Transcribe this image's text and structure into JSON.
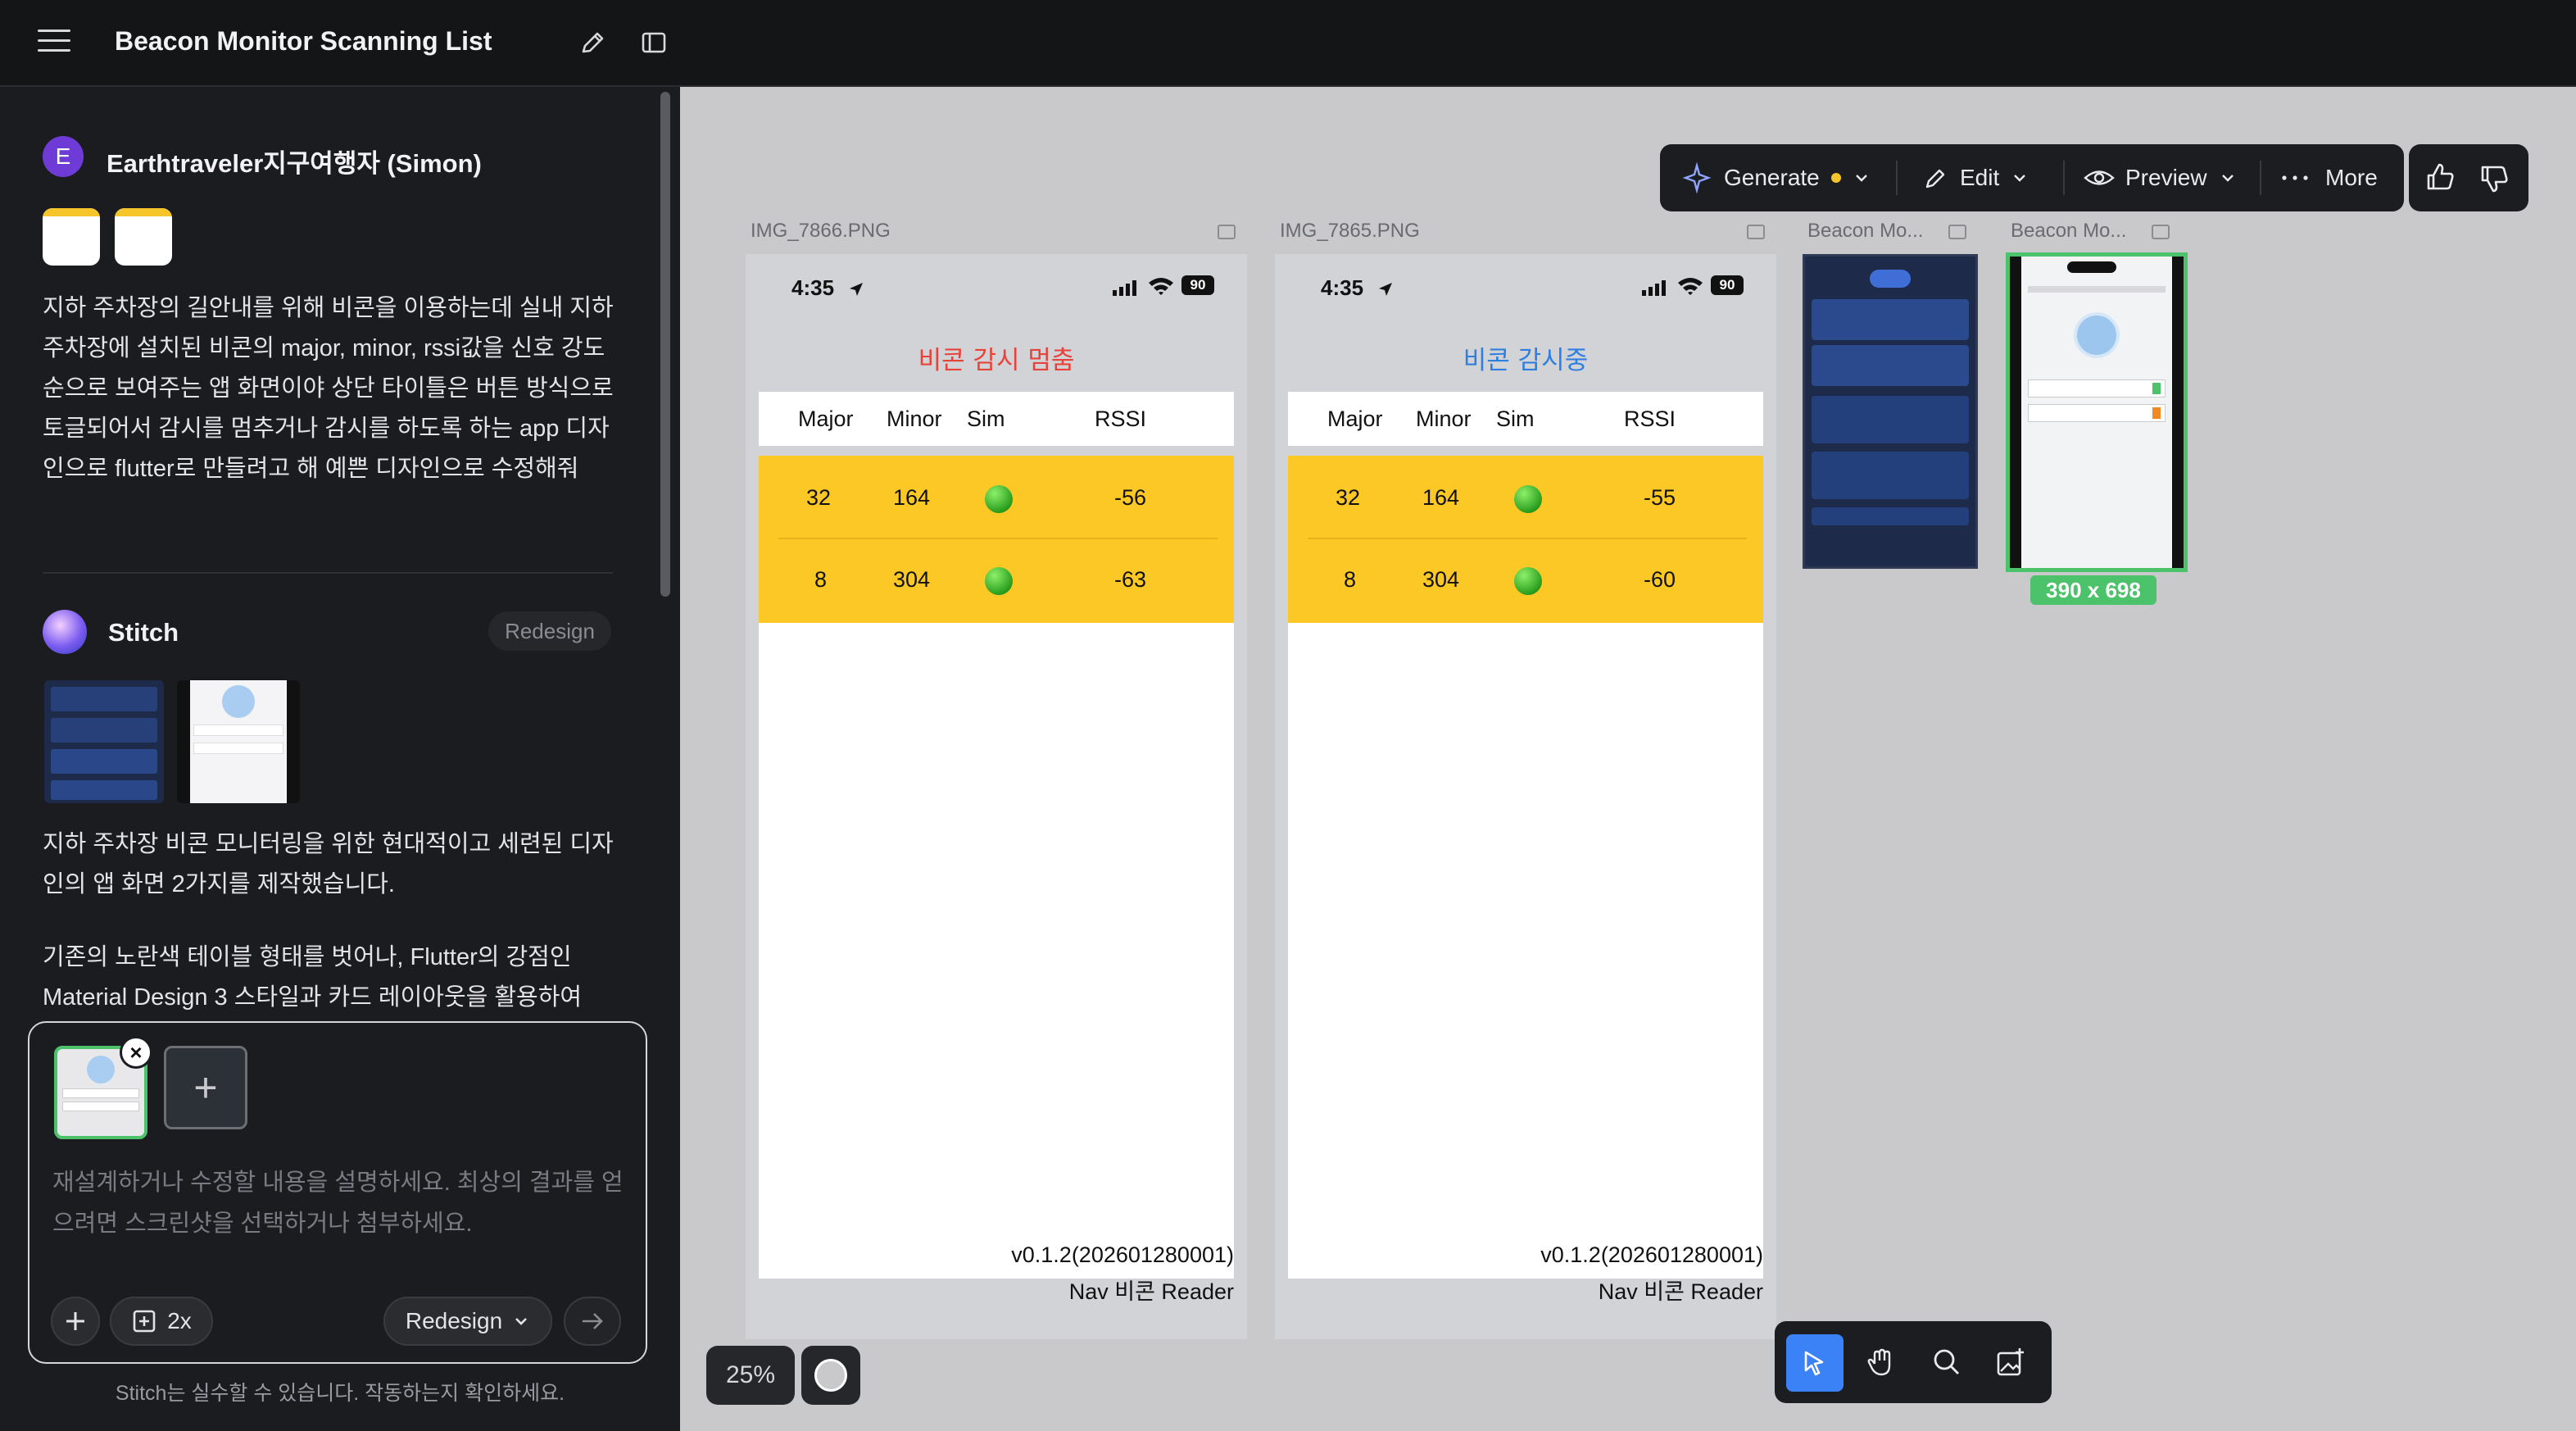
{
  "app": {
    "title": "Beacon Monitor Scanning List"
  },
  "chat": {
    "user": {
      "initial": "E",
      "name": "Earthtraveler지구여행자 (Simon)",
      "message": "지하 주차장의 길안내를 위해 비콘을 이용하는데 실내 지하 주차장에 설치된 비콘의 major, minor, rssi값을 신호 강도 순으로 보여주는 앱 화면이야 상단 타이틀은 버튼 방식으로 토글되어서 감시를 멈추거나 감시를 하도록 하는 app 디자인으로 flutter로 만들려고 해 예쁜 디자인으로 수정해줘"
    },
    "assistant": {
      "name": "Stitch",
      "chip": "Redesign",
      "message1": "지하 주차장 비콘 모니터링을 위한 현대적이고 세련된 디자인의 앱 화면 2가지를 제작했습니다.",
      "message2": "기존의 노란색 테이블 형태를 벗어나, Flutter의 강점인 Material Design 3 스타일과 카드 레이아웃을 활용하여"
    }
  },
  "composer": {
    "placeholder": "재설계하거나 수정할 내용을 설명하세요. 최상의 결과를 얻으려면 스크린샷을 선택하거나 첨부하세요.",
    "multiplier_label": "2x",
    "mode_label": "Redesign",
    "remove_label": "×",
    "add_label": "+",
    "disclaimer": "Stitch는 실수할 수 있습니다. 작동하는지 확인하세요."
  },
  "toolbar": {
    "generate": "Generate",
    "edit": "Edit",
    "preview": "Preview",
    "more": "More"
  },
  "canvas": {
    "zoom": "25%",
    "frames": [
      {
        "label": "IMG_7866.PNG",
        "time": "4:35",
        "battery": "90",
        "title": "비콘 감시 멈춤",
        "title_color": "#e8433a",
        "headers": [
          "Major",
          "Minor",
          "Sim",
          "RSSI"
        ],
        "rows": [
          {
            "major": "32",
            "minor": "164",
            "rssi": "-56"
          },
          {
            "major": "8",
            "minor": "304",
            "rssi": "-63"
          }
        ],
        "version": "v0.1.2(202601280001)",
        "app_name": "Nav 비콘 Reader"
      },
      {
        "label": "IMG_7865.PNG",
        "time": "4:35",
        "battery": "90",
        "title": "비콘 감시중",
        "title_color": "#2f7fe0",
        "headers": [
          "Major",
          "Minor",
          "Sim",
          "RSSI"
        ],
        "rows": [
          {
            "major": "32",
            "minor": "164",
            "rssi": "-55"
          },
          {
            "major": "8",
            "minor": "304",
            "rssi": "-60"
          }
        ],
        "version": "v0.1.2(202601280001)",
        "app_name": "Nav 비콘 Reader"
      }
    ],
    "mini_frames": [
      {
        "label": "Beacon Mo..."
      },
      {
        "label": "Beacon Mo...",
        "size": "390 x 698"
      }
    ]
  },
  "colors": {
    "accent_green": "#4cc36a",
    "row_yellow": "#fcc826",
    "generate_dot": "#f5c52a",
    "select_tool": "#3b82f6"
  }
}
